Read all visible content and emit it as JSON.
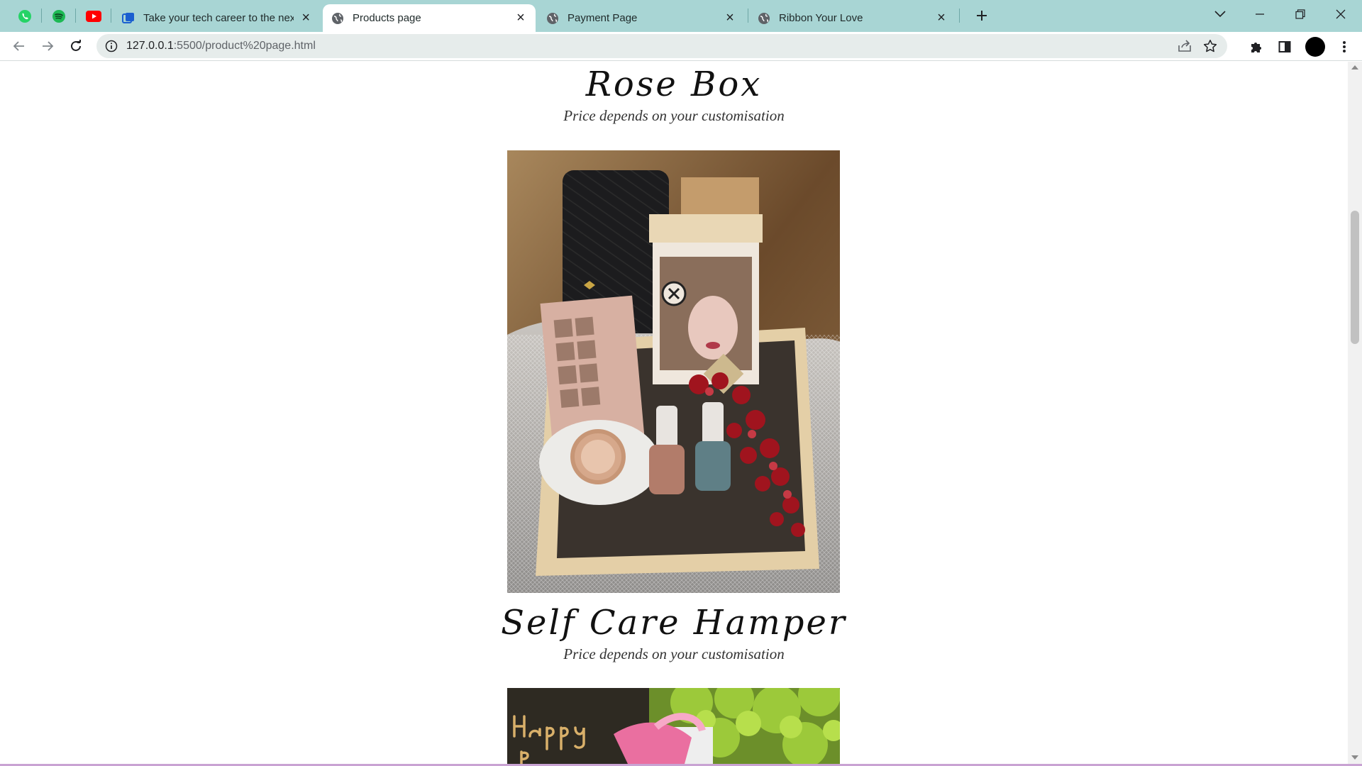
{
  "browser": {
    "pinned_tabs": [
      {
        "name": "whatsapp",
        "color": "#25D366"
      },
      {
        "name": "spotify",
        "color": "#1DB954"
      },
      {
        "name": "youtube",
        "color": "#FF0000"
      }
    ],
    "tabs": [
      {
        "title": "Take your tech career to the next",
        "favicon": "course-icon",
        "active": false
      },
      {
        "title": "Products page",
        "favicon": "globe-icon",
        "active": true
      },
      {
        "title": "Payment Page",
        "favicon": "globe-icon",
        "active": false
      },
      {
        "title": "Ribbon Your Love",
        "favicon": "globe-icon",
        "active": false
      }
    ],
    "address": {
      "host": "127.0.0.1",
      "path": ":5500/product%20page.html"
    },
    "colors": {
      "tabstrip": "#a8d5d4",
      "active_tab": "#ffffff",
      "omnibox": "#e6eceb"
    }
  },
  "products": [
    {
      "name": "Rose Box",
      "price_note": "Price depends on your customisation"
    },
    {
      "name": "Self Care Hamper",
      "price_note": "Price depends on your customisation"
    }
  ],
  "photos": [
    {
      "alt": "Rose box hamper with wallet, face mask, eyeshadow palette, watch, nail polish and red flowers in a wooden tray"
    },
    {
      "alt": "Happy Birthday topper with pink ribbon gift box and greenery"
    }
  ]
}
